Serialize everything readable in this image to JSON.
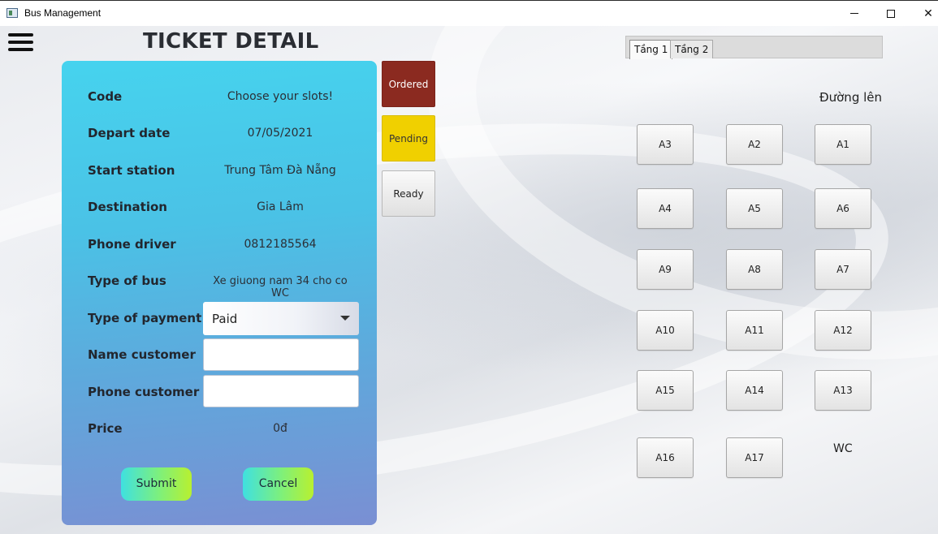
{
  "window": {
    "title": "Bus Management",
    "minimize": "—",
    "maximize": "□",
    "close": "✕"
  },
  "header": {
    "title": "TICKET DETAIL"
  },
  "form": {
    "code": {
      "label": "Code",
      "value": "Choose your slots!"
    },
    "depart_date": {
      "label": "Depart date",
      "value": "07/05/2021"
    },
    "start_station": {
      "label": "Start station",
      "value": "Trung Tâm Đà Nẵng"
    },
    "destination": {
      "label": "Destination",
      "value": "Gia Lâm"
    },
    "phone_driver": {
      "label": "Phone driver",
      "value": "0812185564"
    },
    "type_of_bus": {
      "label": "Type of bus",
      "value": "Xe giuong nam 34 cho co WC"
    },
    "type_of_payment": {
      "label": "Type of payment",
      "selected": "Paid"
    },
    "name_customer": {
      "label": "Name customer",
      "value": ""
    },
    "phone_customer": {
      "label": "Phone customer",
      "value": ""
    },
    "price": {
      "label": "Price",
      "value": "0đ"
    },
    "submit_label": "Submit",
    "cancel_label": "Cancel"
  },
  "legend": {
    "ordered": {
      "label": "Ordered",
      "color": "#8b2a20"
    },
    "pending": {
      "label": "Pending",
      "color": "#f0d000"
    },
    "ready": {
      "label": "Ready",
      "color": "#e6e6e6"
    }
  },
  "tabs": [
    {
      "label": "Tầng 1",
      "active": true
    },
    {
      "label": "Tầng 2",
      "active": false
    }
  ],
  "seat_map": {
    "entrance_label": "Đường lên",
    "wc_label": "WC",
    "seats": [
      "A3",
      "A2",
      "A1",
      "A4",
      "A5",
      "A6",
      "A9",
      "A8",
      "A7",
      "A10",
      "A11",
      "A12",
      "A15",
      "A14",
      "A13",
      "A16",
      "A17"
    ]
  }
}
